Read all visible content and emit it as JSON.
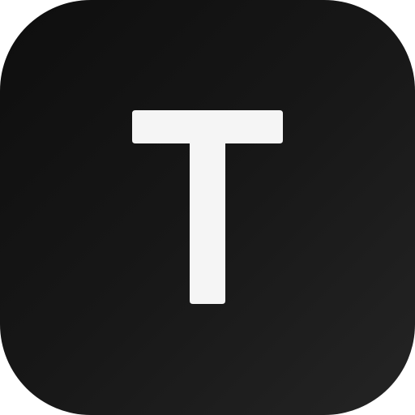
{
  "icon": {
    "name": "app-icon-t",
    "letter": "T",
    "background_colors": [
      "#0e0e0e",
      "#242424"
    ],
    "glyph_color": "#f5f5f5"
  }
}
